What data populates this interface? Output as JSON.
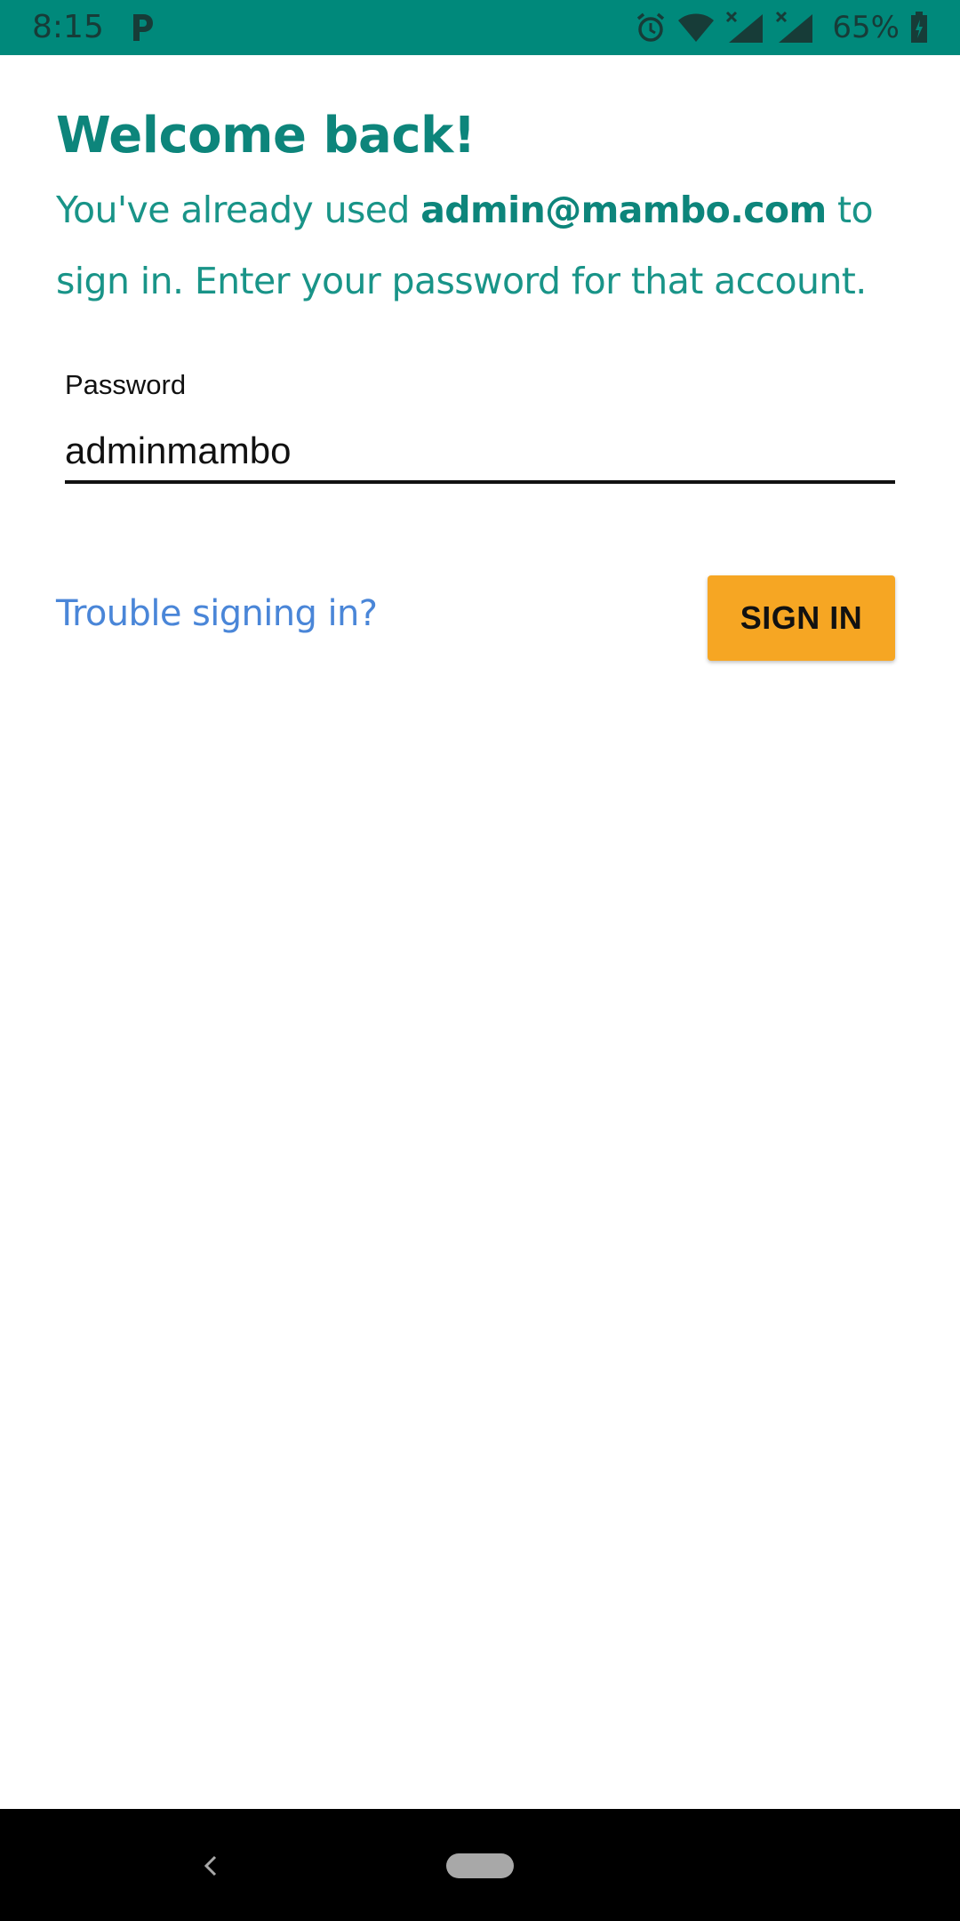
{
  "status_bar": {
    "time": "8:15",
    "notification_icon": "parking-p-icon",
    "icons": [
      "alarm-icon",
      "wifi-icon",
      "signal-no-data-icon",
      "signal-no-data-icon"
    ],
    "battery_text": "65%",
    "battery_icon": "battery-charging-icon",
    "background_color": "#00897b"
  },
  "welcome": {
    "title": "Welcome back!",
    "body_prefix": "You've already used ",
    "email": "admin@mambo.com",
    "body_suffix": " to sign in. Enter your password for that account.",
    "text_color": "#0d857b"
  },
  "password_field": {
    "label": "Password",
    "value": "adminmambo"
  },
  "actions": {
    "trouble_link": "Trouble signing in?",
    "sign_in_label": "SIGN IN",
    "sign_in_color": "#f6a623",
    "link_color": "#4a86d8"
  },
  "nav_bar": {
    "back_icon": "back-chevron-icon",
    "home_icon": "home-pill-icon"
  }
}
